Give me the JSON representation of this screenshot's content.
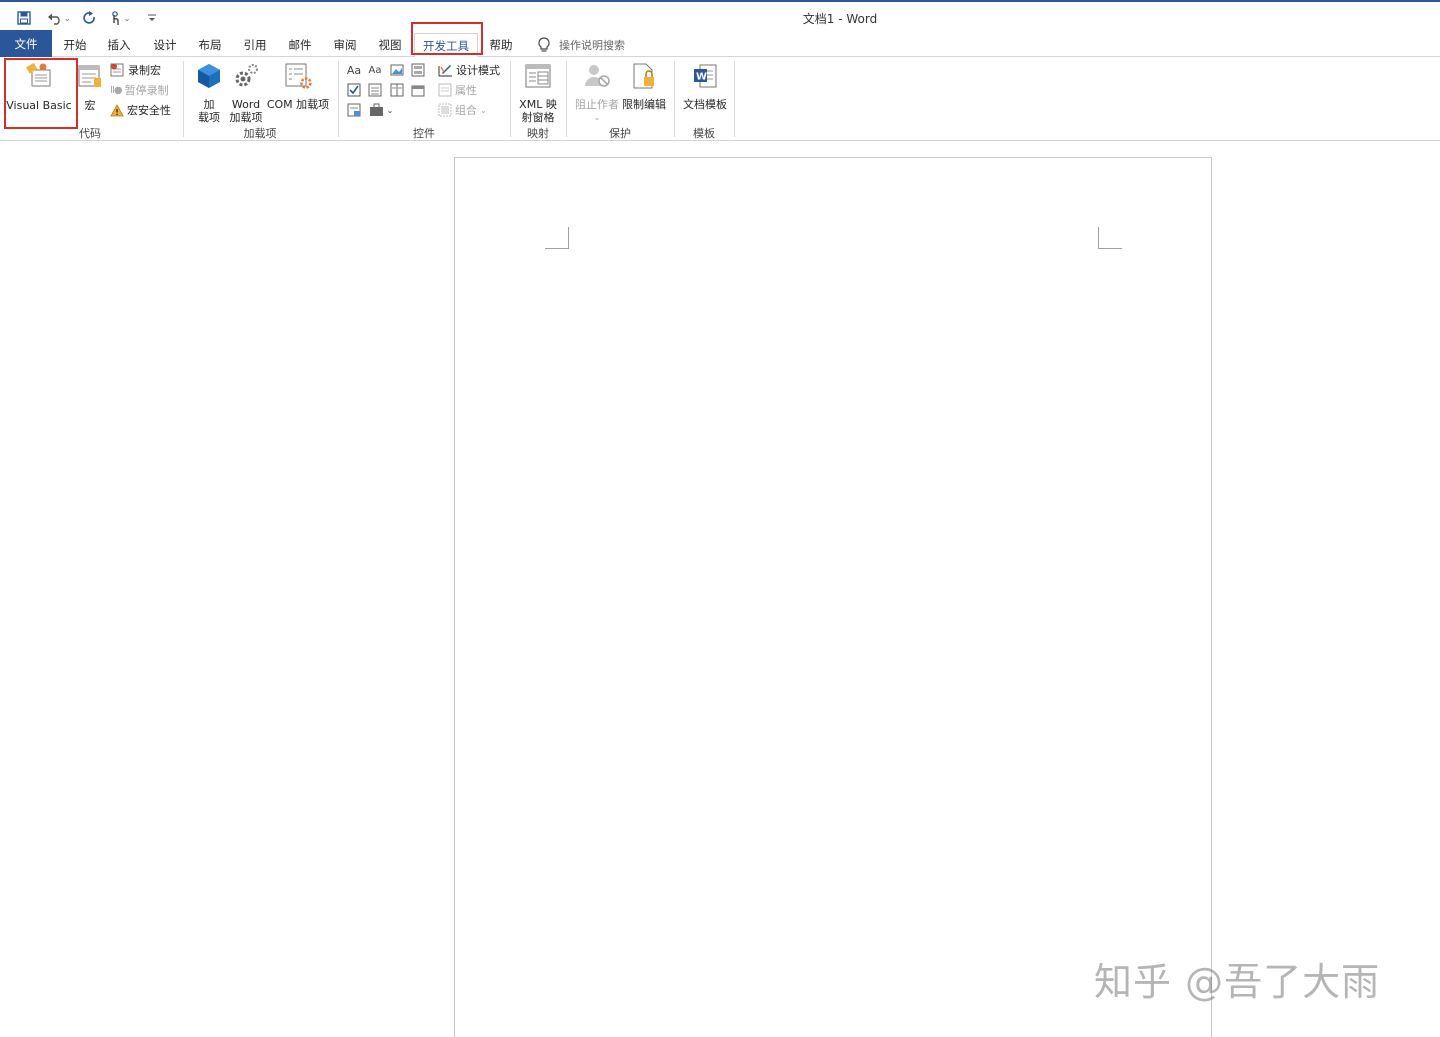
{
  "window": {
    "title": "文档1  -  Word"
  },
  "quick_access": {
    "save_icon": "save-icon",
    "undo_icon": "undo-icon",
    "redo_icon": "redo-icon",
    "touch_icon": "touch-mode-icon",
    "customize_label": "⌄"
  },
  "tabs": [
    {
      "label": "文件"
    },
    {
      "label": "开始"
    },
    {
      "label": "插入"
    },
    {
      "label": "设计"
    },
    {
      "label": "布局"
    },
    {
      "label": "引用"
    },
    {
      "label": "邮件"
    },
    {
      "label": "审阅"
    },
    {
      "label": "视图"
    },
    {
      "label": "开发工具"
    },
    {
      "label": "帮助"
    }
  ],
  "tell_me": {
    "placeholder": "操作说明搜索"
  },
  "ribbon": {
    "code": {
      "label": "代码",
      "visual_basic": "Visual Basic",
      "macros": "宏",
      "record_macro": "录制宏",
      "pause_recording": "暂停录制",
      "macro_security": "宏安全性"
    },
    "addins": {
      "label": "加载项",
      "addins_line1": "加",
      "addins_line2": "载项",
      "word_addins_line1": "Word",
      "word_addins_line2": "加载项",
      "com_addins": "COM 加载项"
    },
    "controls": {
      "label": "控件",
      "rich_text": "Aa",
      "plain_text": "Aa",
      "design_mode": "设计模式",
      "properties": "属性",
      "group": "组合"
    },
    "mapping": {
      "label": "映射",
      "xml_line1": "XML 映",
      "xml_line2": "射窗格"
    },
    "protect": {
      "label": "保护",
      "block_authors": "阻止作者",
      "restrict_editing": "限制编辑"
    },
    "templates": {
      "label": "模板",
      "document_template": "文档模板"
    }
  },
  "watermark": "知乎 @吾了大雨",
  "colors": {
    "accent": "#2b579a",
    "highlight": "#d0312d"
  }
}
